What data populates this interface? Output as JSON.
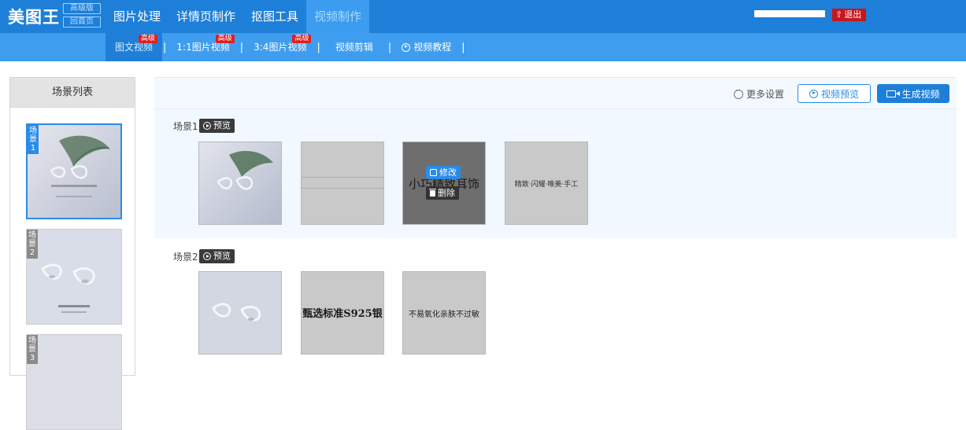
{
  "header": {
    "logo_text": "美图王",
    "logo_badges": [
      "高级版",
      "回首页"
    ],
    "nav": [
      {
        "label": "图片处理"
      },
      {
        "label": "详情页制作"
      },
      {
        "label": "抠图工具"
      },
      {
        "label": "视频制作",
        "active": true
      }
    ],
    "logout_label": "退出"
  },
  "subnav": {
    "items": [
      {
        "label": "图文视频",
        "active": true,
        "badge": "高级"
      },
      {
        "label": "1:1图片视频",
        "badge": "高级"
      },
      {
        "label": "3:4图片视频",
        "badge": "高级"
      },
      {
        "label": "视频剪辑"
      },
      {
        "label": "视频教程",
        "icon": "play-circle-icon"
      }
    ]
  },
  "left_panel": {
    "title": "场景列表",
    "scenes": [
      {
        "label": "场景1",
        "selected": true,
        "caption": "小巧精致耳饰"
      },
      {
        "label": "场景2",
        "caption": "甄选标准S925银"
      },
      {
        "label": "场景3"
      }
    ]
  },
  "toolbar": {
    "settings_label": "更多设置",
    "preview_label": "视频预览",
    "generate_label": "生成视频"
  },
  "scenes": [
    {
      "title": "场景1",
      "preview_label": "预览",
      "frames": [
        {
          "type": "image",
          "caption": ""
        },
        {
          "type": "blank"
        },
        {
          "type": "text",
          "text": "小巧精致耳饰",
          "hover": true
        },
        {
          "type": "text",
          "text": "精致·闪耀·唯美·手工"
        }
      ],
      "actions": {
        "edit": "修改",
        "delete": "删除"
      }
    },
    {
      "title": "场景2",
      "preview_label": "预览",
      "frames": [
        {
          "type": "image"
        },
        {
          "type": "text",
          "text": "甄选标准S925银"
        },
        {
          "type": "text",
          "text": "不易氧化亲肤不过敏"
        }
      ]
    }
  ],
  "colors": {
    "topbar": "#1e7fd8",
    "subbar": "#3f9df0",
    "accent": "#2a8be8",
    "logout": "#c8161d",
    "scene_bg": "#f1f8ff"
  }
}
